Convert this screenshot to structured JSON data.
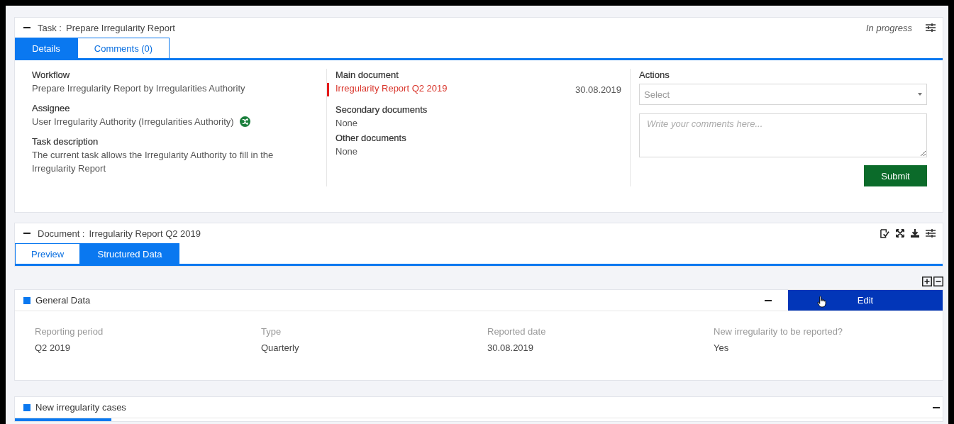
{
  "task": {
    "label": "Task :",
    "title": "Prepare Irregularity Report",
    "expanded": true,
    "status": "In progress",
    "tabs": [
      {
        "label": "Details",
        "selected": true
      },
      {
        "label": "Comments (0)",
        "selected": false
      }
    ],
    "info": [
      {
        "label": "Workflow",
        "value": "Prepare Irregularity Report by Irregularities Authority",
        "reassign": false
      },
      {
        "label": "Assignee",
        "value": "User Irregularity Authority (Irregularities Authority)",
        "reassign": true
      },
      {
        "label": "Task description",
        "value": "The current task allows the Irregularity Authority to fill in the Irregularity Report",
        "reassign": false
      }
    ],
    "main_document": {
      "label": "Main document",
      "name": "Irregularity Report Q2 2019",
      "date": "30.08.2019"
    },
    "documents": [
      {
        "label": "Secondary documents",
        "value": "None"
      },
      {
        "label": "Other documents",
        "value": "None"
      }
    ],
    "actions": {
      "label": "Actions",
      "select_placeholder": "Select",
      "comment_placeholder": "Write your comments here...",
      "submit": "Submit"
    }
  },
  "document": {
    "label": "Document :",
    "title": "Irregularity Report Q2 2019",
    "expanded": true,
    "tabs": [
      {
        "label": "Preview",
        "selected": false
      },
      {
        "label": "Structured Data",
        "selected": true
      }
    ]
  },
  "sections": [
    {
      "title": "General Data",
      "expanded": true,
      "edit": "Edit",
      "fields": [
        {
          "label": "Reporting period",
          "value": "Q2 2019"
        },
        {
          "label": "Type",
          "value": "Quarterly"
        },
        {
          "label": "Reported date",
          "value": "30.08.2019"
        },
        {
          "label": "New irregularity to be reported?",
          "value": "Yes"
        }
      ]
    },
    {
      "title": "New irregularity cases",
      "expanded": true
    }
  ]
}
